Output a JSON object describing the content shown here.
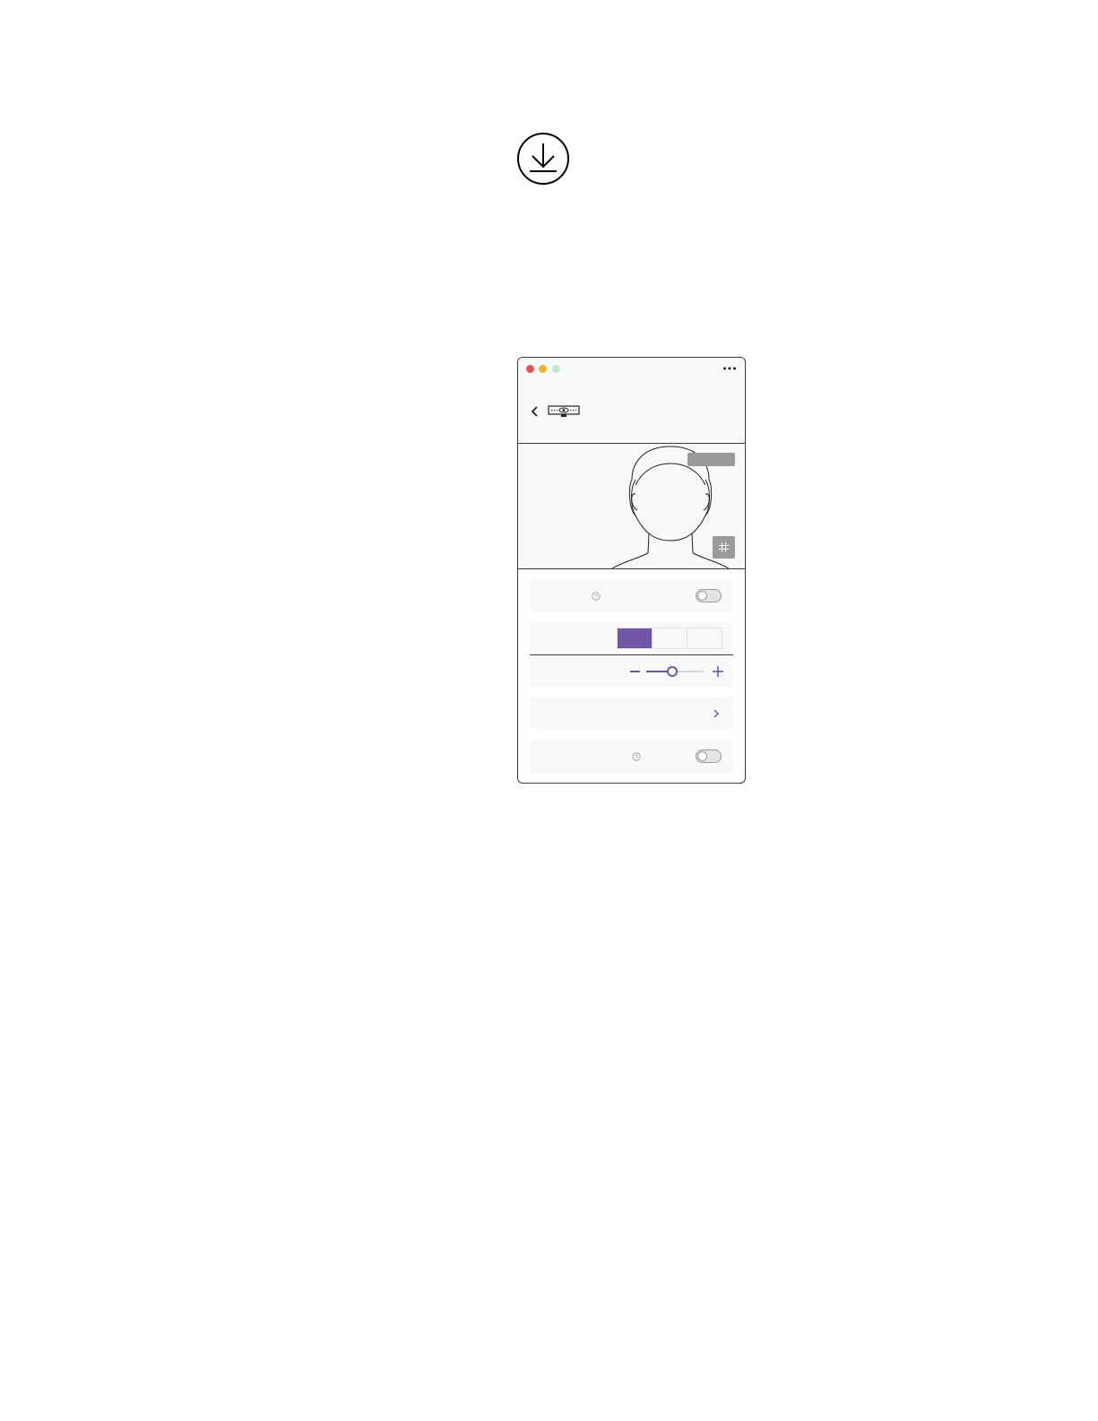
{
  "icons": {
    "download": "download-icon",
    "more": "more-horizontal-icon",
    "back": "chevron-left-icon",
    "device": "webcam-icon",
    "grid": "grid-icon",
    "help": "help-circle-icon",
    "minus": "minus-icon",
    "plus": "plus-icon",
    "chevron": "chevron-right-icon"
  },
  "colors": {
    "accent": "#7155a6",
    "panel": "#f7f8fa",
    "neutral": "#9b9a9a",
    "close": "#e5534b",
    "minimize": "#f0b133",
    "zoom": "#c5e7cd"
  },
  "settings": {
    "toggle_1": {
      "on": false
    },
    "segmented": {
      "segments": 3,
      "selected_index": 0
    },
    "zoom_slider": {
      "value": 0.45
    },
    "toggle_2": {
      "on": false
    }
  }
}
